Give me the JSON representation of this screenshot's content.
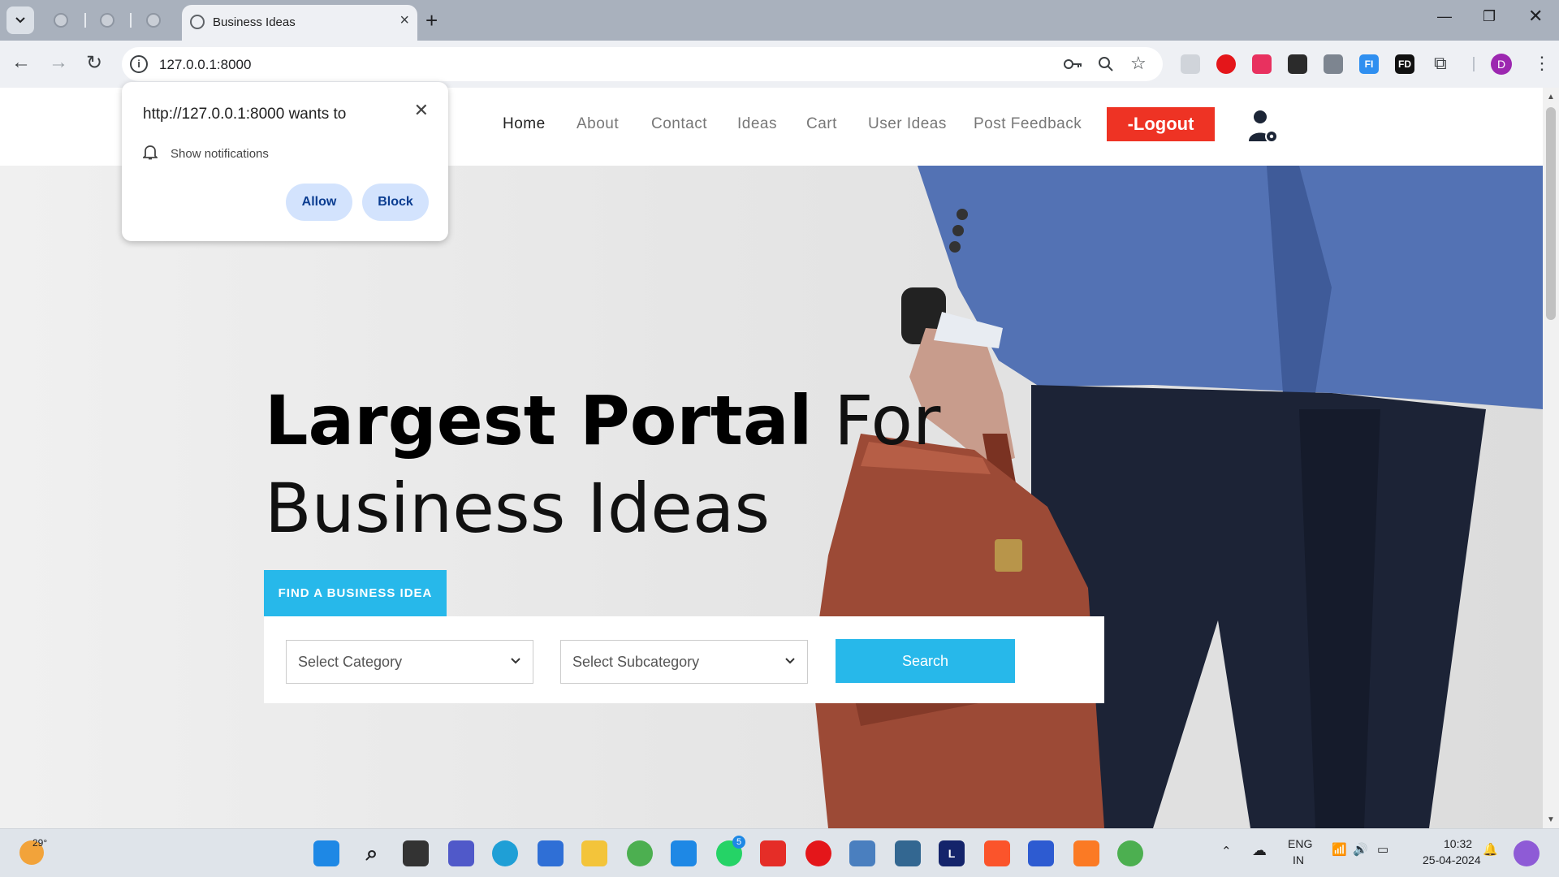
{
  "browser": {
    "active_tab_title": "Business Ideas",
    "new_tab_symbol": "+",
    "url": "127.0.0.1:8000",
    "profile_initial": "D",
    "extensions": [
      "FI",
      "FD"
    ]
  },
  "site": {
    "nav": [
      "Home",
      "About",
      "Contact",
      "Ideas",
      "Cart",
      "User Ideas",
      "Post Feedback"
    ],
    "logout_label": "-Logout",
    "hero_title_bold": "Largest Portal",
    "hero_title_light_1": " For",
    "hero_title_light_2": "Business Ideas",
    "find_tab_label": "FIND A BUSINESS IDEA",
    "category_placeholder": "Select Category",
    "subcategory_placeholder": "Select Subcategory",
    "search_label": "Search"
  },
  "permission_popup": {
    "heading": "http://127.0.0.1:8000 wants to",
    "item": "Show notifications",
    "allow": "Allow",
    "block": "Block"
  },
  "taskbar": {
    "weather": "29°",
    "whatsapp_badge": "5",
    "lang_1": "ENG",
    "lang_2": "IN",
    "time": "10:32",
    "date": "25-04-2024"
  }
}
